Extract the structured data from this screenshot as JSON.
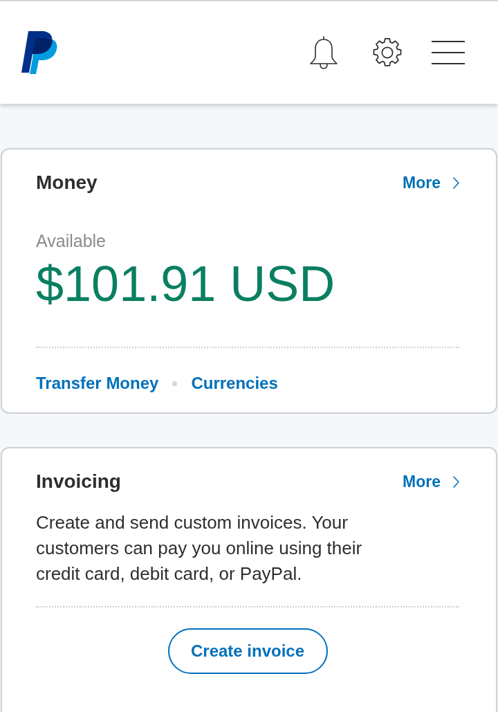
{
  "cards": [
    {
      "kind": "balance",
      "title": "Money",
      "more_link": "More",
      "balance_label": "Available",
      "balance": "$101.91 USD",
      "links": [
        "Transfer Money",
        "Currencies"
      ]
    },
    {
      "kind": "info",
      "title": "Invoicing",
      "more_link": "More",
      "description": "Create and send custom invoices. Your customers can pay you online using their credit card, debit card, or PayPal.",
      "button": "Create invoice"
    }
  ]
}
